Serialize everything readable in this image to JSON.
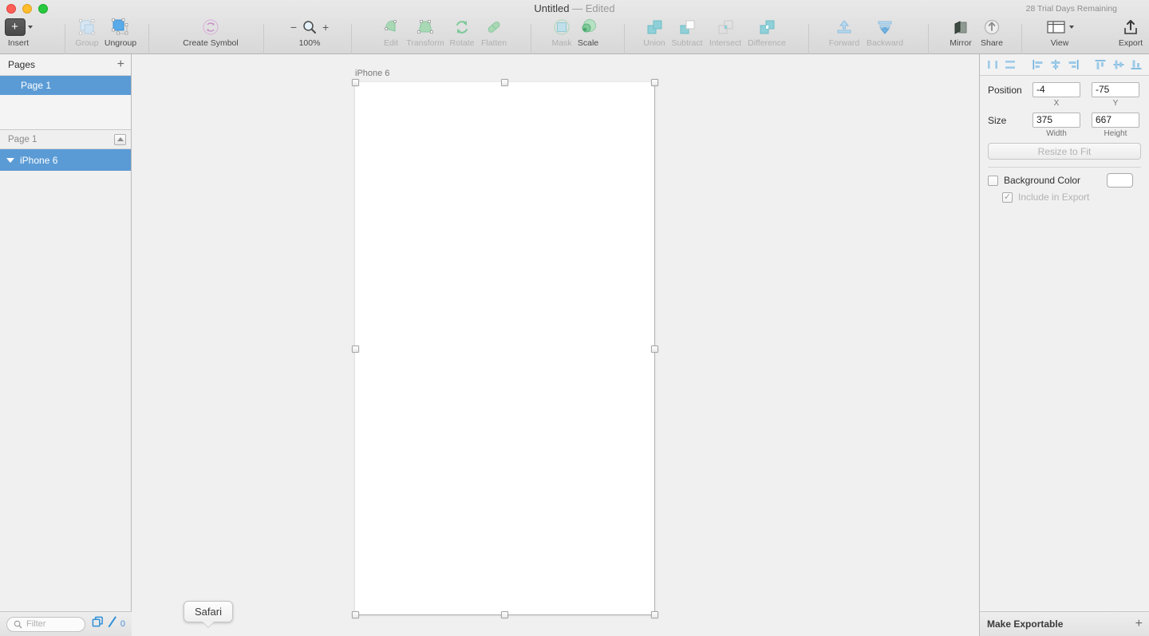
{
  "window": {
    "title": "Untitled",
    "dash": "—",
    "edited": "Edited",
    "trial": "28 Trial Days Remaining"
  },
  "toolbar": {
    "items": [
      {
        "name": "insert",
        "label": "Insert",
        "icon": "plus-icon",
        "enabled": true
      },
      {
        "name": "group",
        "label": "Group",
        "icon": "group-icon",
        "enabled": false
      },
      {
        "name": "ungroup",
        "label": "Ungroup",
        "icon": "ungroup-icon",
        "enabled": true
      },
      {
        "name": "create-symbol",
        "label": "Create Symbol",
        "icon": "symbol-icon",
        "enabled": true
      },
      {
        "name": "zoom",
        "label": "100%",
        "icon": "magnifier-icon",
        "enabled": true
      },
      {
        "name": "edit",
        "label": "Edit",
        "icon": "edit-icon",
        "enabled": false
      },
      {
        "name": "transform",
        "label": "Transform",
        "icon": "transform-icon",
        "enabled": false
      },
      {
        "name": "rotate",
        "label": "Rotate",
        "icon": "rotate-icon",
        "enabled": false
      },
      {
        "name": "flatten",
        "label": "Flatten",
        "icon": "flatten-icon",
        "enabled": false
      },
      {
        "name": "mask",
        "label": "Mask",
        "icon": "mask-icon",
        "enabled": false
      },
      {
        "name": "scale",
        "label": "Scale",
        "icon": "scale-icon",
        "enabled": true
      },
      {
        "name": "union",
        "label": "Union",
        "icon": "union-icon",
        "enabled": false
      },
      {
        "name": "subtract",
        "label": "Subtract",
        "icon": "subtract-icon",
        "enabled": false
      },
      {
        "name": "intersect",
        "label": "Intersect",
        "icon": "intersect-icon",
        "enabled": false
      },
      {
        "name": "difference",
        "label": "Difference",
        "icon": "difference-icon",
        "enabled": false
      },
      {
        "name": "forward",
        "label": "Forward",
        "icon": "forward-icon",
        "enabled": false
      },
      {
        "name": "backward",
        "label": "Backward",
        "icon": "backward-icon",
        "enabled": false
      },
      {
        "name": "mirror",
        "label": "Mirror",
        "icon": "mirror-icon",
        "enabled": true
      },
      {
        "name": "share",
        "label": "Share",
        "icon": "share-icon",
        "enabled": true
      },
      {
        "name": "view",
        "label": "View",
        "icon": "view-icon",
        "enabled": true
      },
      {
        "name": "export",
        "label": "Export",
        "icon": "export-icon",
        "enabled": true
      }
    ],
    "zoom_minus": "−",
    "zoom_plus": "+",
    "zoom_level": "100%"
  },
  "pages": {
    "header": "Pages",
    "add_label": "+",
    "items": [
      {
        "label": "Page 1",
        "selected": true
      }
    ]
  },
  "layers": {
    "header": "Page 1",
    "items": [
      {
        "label": "iPhone 6",
        "selected": true,
        "expanded": true
      }
    ]
  },
  "left_footer": {
    "filter_placeholder": "Filter",
    "count": "0"
  },
  "canvas": {
    "artboard_label": "iPhone 6",
    "tooltip": "Safari"
  },
  "inspector": {
    "align": [
      {
        "name": "distribute-horizontally",
        "icon": "distribute-h-icon"
      },
      {
        "name": "distribute-vertically",
        "icon": "distribute-v-icon"
      },
      {
        "name": "align-left",
        "icon": "align-left-icon"
      },
      {
        "name": "align-center-h",
        "icon": "align-center-h-icon"
      },
      {
        "name": "align-right",
        "icon": "align-right-icon"
      },
      {
        "name": "align-top",
        "icon": "align-top-icon"
      },
      {
        "name": "align-middle-v",
        "icon": "align-middle-v-icon"
      },
      {
        "name": "align-bottom",
        "icon": "align-bottom-icon"
      }
    ],
    "position_label": "Position",
    "x_value": "-4",
    "y_value": "-75",
    "x_sub": "X",
    "y_sub": "Y",
    "size_label": "Size",
    "width_value": "375",
    "height_value": "667",
    "width_sub": "Width",
    "height_sub": "Height",
    "resize_to_fit": "Resize to Fit",
    "background_color_label": "Background Color",
    "background_color_checked": false,
    "include_in_export_label": "Include in Export",
    "include_in_export_checked": true,
    "swatch_color": "#ffffff",
    "make_exportable": "Make Exportable",
    "make_exportable_add": "+"
  },
  "colors": {
    "selection_blue": "#5b9bd5",
    "accent_blue": "#4a90d9",
    "toolbar_green": "#7fc99a",
    "toolbar_teal": "#7fc6cc"
  }
}
